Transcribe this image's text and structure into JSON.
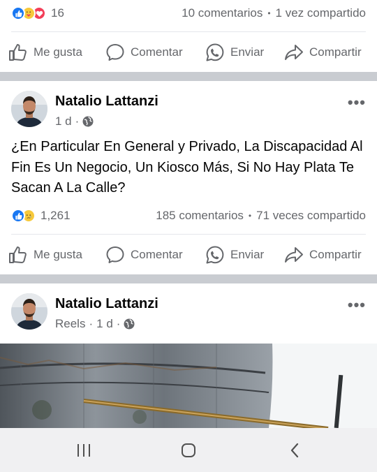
{
  "post1": {
    "reaction_icons": [
      "like-icon",
      "care-icon",
      "love-icon"
    ],
    "reaction_count": "16",
    "comments": "10 comentarios",
    "shares": "1 vez compartido",
    "actions": {
      "like": "Me gusta",
      "comment": "Comentar",
      "send": "Enviar",
      "share": "Compartir"
    }
  },
  "post2": {
    "author": "Natalio Lattanzi",
    "time": "1 d",
    "separator": "·",
    "privacy_icon": "globe-icon",
    "text": "¿En Particular En General y Privado, La Discapacidad Al Fin Es Un Negocio, Un Kiosco Más, Si No Hay Plata Te Sacan A La Calle?",
    "reaction_icons": [
      "like-icon",
      "sad-icon"
    ],
    "reaction_count": "1,261",
    "comments": "185 comentarios",
    "shares": "71 veces compartido",
    "actions": {
      "like": "Me gusta",
      "comment": "Comentar",
      "send": "Enviar",
      "share": "Compartir"
    }
  },
  "post3": {
    "author": "Natalio Lattanzi",
    "source": "Reels",
    "time": "1 d",
    "separator": "·",
    "privacy_icon": "globe-icon"
  },
  "stats_separator": "•",
  "more_label": "•••",
  "system_nav": {
    "icons": [
      "recent-apps-icon",
      "home-icon",
      "back-icon"
    ]
  },
  "colors": {
    "accent": "#1877f2",
    "text": "#050505",
    "secondary": "#65676b",
    "separator": "#c9ccd1",
    "love": "#f33e58",
    "care": "#f7c93a"
  }
}
